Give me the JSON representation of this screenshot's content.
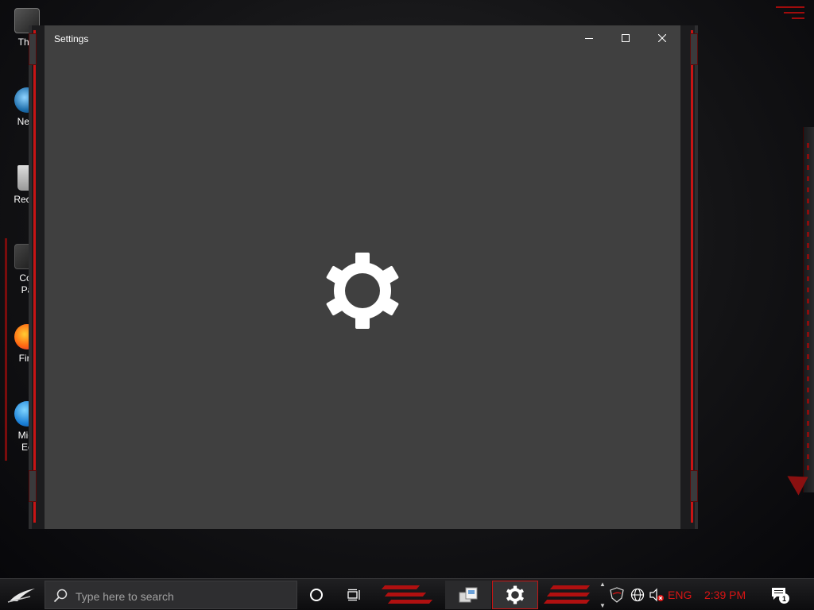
{
  "window": {
    "title": "Settings",
    "controls": {
      "minimize": "minimize-icon",
      "maximize": "maximize-icon",
      "close": "close-icon"
    },
    "splash_icon": "gear-icon",
    "background_color": "#404040"
  },
  "desktop": {
    "icons": [
      {
        "label": "This",
        "icon": "this-pc-icon"
      },
      {
        "label": "Netv",
        "icon": "network-icon"
      },
      {
        "label": "Recyc",
        "icon": "recycle-bin-icon"
      },
      {
        "label": "Cor",
        "label2": "Pa",
        "icon": "control-panel-icon"
      },
      {
        "label": "Fire",
        "icon": "firefox-icon"
      },
      {
        "label": "Micr",
        "label2": "Ec",
        "icon": "edge-icon"
      }
    ],
    "accent_color": "#c81414"
  },
  "taskbar": {
    "start_icon": "rog-start-icon",
    "search_placeholder": "Type here to search",
    "cortana_icon": "cortana-circle-icon",
    "task_view_icon": "task-view-icon",
    "apps": [
      {
        "icon": "app-package-icon",
        "active": false
      },
      {
        "icon": "gear-icon",
        "active": true
      }
    ],
    "tray": {
      "shield_icon": "rog-shield-icon",
      "network_icon": "globe-network-icon",
      "volume_icon": "volume-muted-icon",
      "language": "ENG",
      "time": "2:39 PM",
      "notifications_icon": "action-center-icon",
      "notifications_count": "1"
    }
  }
}
